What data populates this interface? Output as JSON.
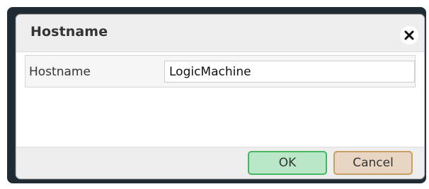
{
  "dialog": {
    "title": "Hostname",
    "close_icon": "close-icon",
    "field": {
      "label": "Hostname",
      "value": "LogicMachine"
    },
    "buttons": {
      "ok_label": "OK",
      "cancel_label": "Cancel"
    },
    "colors": {
      "ok_background": "#b9e7c8",
      "ok_border": "#47b75f",
      "cancel_background": "#e9d6c2",
      "cancel_border": "#c8a05d"
    }
  }
}
